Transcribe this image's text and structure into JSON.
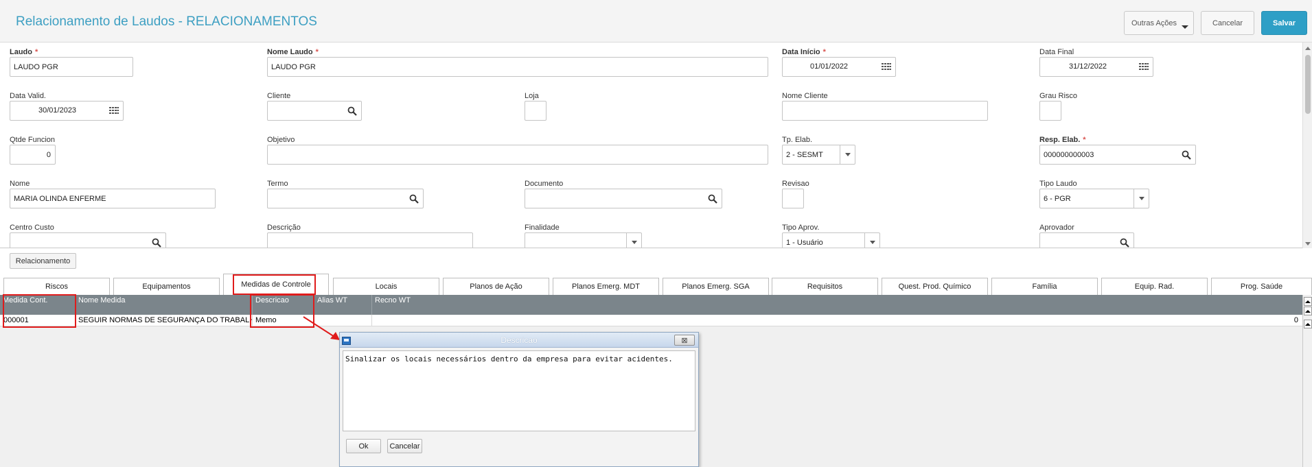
{
  "header": {
    "title": "Relacionamento de Laudos - RELACIONAMENTOS",
    "outras_acoes": "Outras Ações",
    "cancelar": "Cancelar",
    "salvar": "Salvar"
  },
  "form": {
    "laudo": {
      "label": "Laudo",
      "value": "LAUDO PGR"
    },
    "nome_laudo": {
      "label": "Nome Laudo",
      "value": "LAUDO PGR"
    },
    "data_inicio": {
      "label": "Data Início",
      "value": "01/01/2022"
    },
    "data_final": {
      "label": "Data Final",
      "value": "31/12/2022"
    },
    "data_valid": {
      "label": "Data Valid.",
      "value": "30/01/2023"
    },
    "cliente": {
      "label": "Cliente",
      "value": ""
    },
    "loja": {
      "label": "Loja",
      "value": ""
    },
    "nome_cliente": {
      "label": "Nome Cliente",
      "value": ""
    },
    "grau_risco": {
      "label": "Grau Risco",
      "value": ""
    },
    "qtde_funcion": {
      "label": "Qtde Funcion",
      "value": "0"
    },
    "objetivo": {
      "label": "Objetivo",
      "value": ""
    },
    "tp_elab": {
      "label": "Tp. Elab.",
      "value": "2 - SESMT"
    },
    "resp_elab": {
      "label": "Resp. Elab.",
      "value": "000000000003"
    },
    "nome": {
      "label": "Nome",
      "value": "MARIA OLINDA ENFERME"
    },
    "termo": {
      "label": "Termo",
      "value": ""
    },
    "documento": {
      "label": "Documento",
      "value": ""
    },
    "revisao": {
      "label": "Revisao",
      "value": ""
    },
    "tipo_laudo": {
      "label": "Tipo Laudo",
      "value": "6 - PGR"
    },
    "centro_custo": {
      "label": "Centro Custo",
      "value": ""
    },
    "descricao": {
      "label": "Descrição",
      "value": ""
    },
    "finalidade": {
      "label": "Finalidade",
      "value": ""
    },
    "tipo_aprov": {
      "label": "Tipo Aprov.",
      "value": "1 - Usuário"
    },
    "aprovador": {
      "label": "Aprovador",
      "value": ""
    },
    "required_mark": "*"
  },
  "relacionamento_button": "Relacionamento",
  "tabs": [
    "Riscos",
    "Equipamentos",
    "Medidas de Controle",
    "Locais",
    "Planos de Ação",
    "Planos Emerg. MDT",
    "Planos Emerg. SGA",
    "Requisitos",
    "Quest. Prod. Químico",
    "Família",
    "Equip. Rad.",
    "Prog. Saúde"
  ],
  "active_tab": "Medidas de Controle",
  "grid": {
    "columns": [
      "Medida Cont.",
      "Nome Medida",
      "Descricao",
      "Alias WT",
      "Recno WT"
    ],
    "rows": [
      {
        "medida": "000001",
        "nome": "SEGUIR NORMAS DE SEGURANÇA DO TRABALHO",
        "descricao": "Memo",
        "alias": "",
        "recno": "0"
      }
    ]
  },
  "dialog": {
    "title": "Descricao",
    "text": "Sinalizar os locais necessários dentro da empresa para evitar acidentes.",
    "ok": "Ok",
    "cancelar": "Cancelar",
    "close_glyph": "⊠"
  },
  "colors": {
    "accent": "#2e9fc6",
    "title": "#3d9fc2",
    "grid_header": "#7b858b",
    "highlight": "#e01b1b"
  },
  "icons": {
    "search": "search-icon",
    "calendar": "calendar-icon",
    "dropdown": "chevron-down-icon"
  }
}
